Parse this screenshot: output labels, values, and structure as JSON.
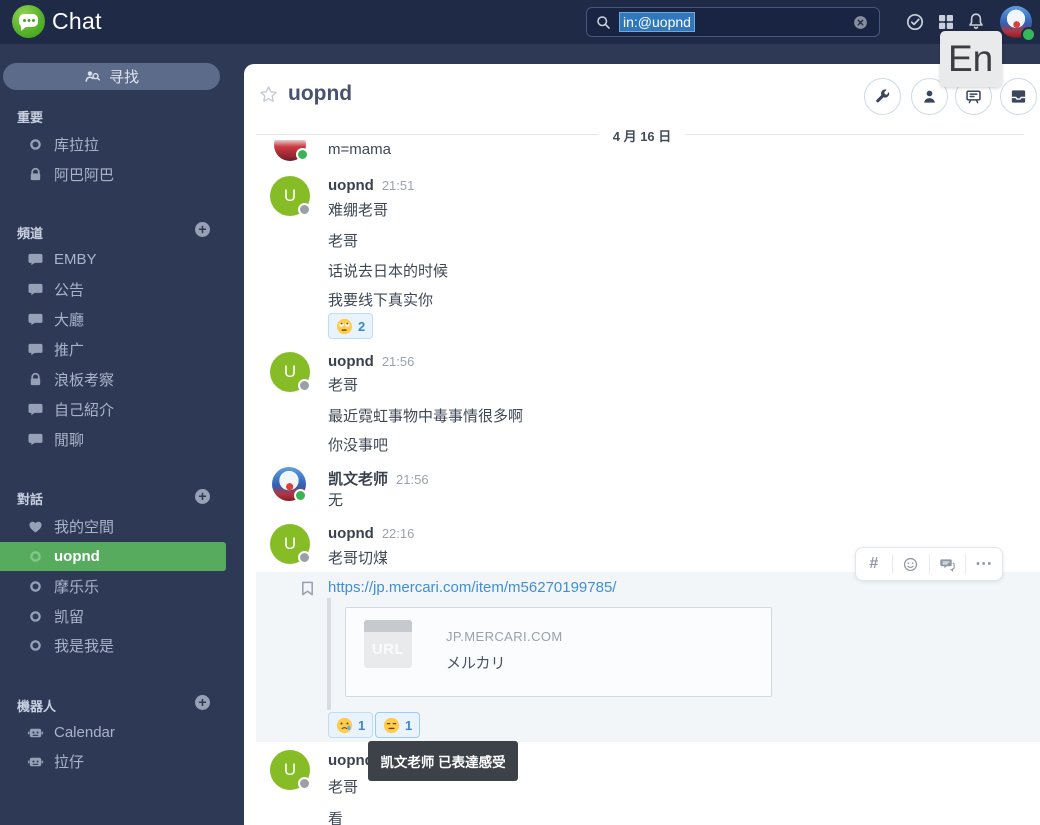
{
  "topbar": {
    "app_name": "Chat",
    "search_value": "in:@uopnd"
  },
  "ime_overlay": {
    "label": "En"
  },
  "sidebar": {
    "find_button": "寻找",
    "sections": [
      {
        "label": "重要",
        "items": [
          {
            "label": "库拉拉",
            "icon": "ring"
          },
          {
            "label": "阿巴阿巴",
            "icon": "lock"
          }
        ]
      },
      {
        "label": "頻道",
        "items": [
          {
            "label": "EMBY",
            "icon": "speech-bubble"
          },
          {
            "label": "公告",
            "icon": "speech-bubble"
          },
          {
            "label": "大廳",
            "icon": "speech-bubble"
          },
          {
            "label": "推广",
            "icon": "speech-bubble"
          },
          {
            "label": "浪板考察",
            "icon": "lock"
          },
          {
            "label": "自己紹介",
            "icon": "speech-bubble"
          },
          {
            "label": "閒聊",
            "icon": "speech-bubble"
          }
        ]
      },
      {
        "label": "對話",
        "items": [
          {
            "label": "我的空間",
            "icon": "heart"
          },
          {
            "label": "uopnd",
            "icon": "ring",
            "active": true
          },
          {
            "label": "摩乐乐",
            "icon": "ring"
          },
          {
            "label": "凯留",
            "icon": "ring"
          },
          {
            "label": "我是我是",
            "icon": "ring"
          }
        ]
      },
      {
        "label": "機器人",
        "items": [
          {
            "label": "Calendar",
            "icon": "robot"
          },
          {
            "label": "拉仔",
            "icon": "robot"
          }
        ]
      }
    ]
  },
  "main": {
    "header": {
      "title": "uopnd"
    },
    "date_divider": "4 月 16 日",
    "toolbar": {
      "hash": "#",
      "more": "⋯"
    },
    "tooltip": "凯文老师 已表達感受",
    "messages": {
      "mama": {
        "text": "m=mama"
      },
      "m1": {
        "user": "uopnd",
        "avatar_letter": "U",
        "time": "21:51",
        "text": "难绷老哥",
        "followups": [
          "老哥",
          "话说去日本的时候",
          "我要线下真实你"
        ],
        "reaction": {
          "emoji": "face-with-rolling-eyes",
          "count": "2"
        }
      },
      "m2": {
        "user": "uopnd",
        "avatar_letter": "U",
        "time": "21:56",
        "text": "老哥",
        "followups": [
          "最近霓虹事物中毒事情很多啊",
          "你没事吧"
        ]
      },
      "m3": {
        "user": "凯文老师",
        "time": "21:56",
        "text": "无"
      },
      "m4": {
        "user": "uopnd",
        "avatar_letter": "U",
        "time": "22:16",
        "text": "老哥切煤"
      },
      "link_msg": {
        "url": "https://jp.mercari.com/item/m56270199785/",
        "preview": {
          "icon_label": "URL",
          "site": "JP.MERCARI.COM",
          "title": "メルカリ"
        },
        "reactions": [
          {
            "emoji": "crying-face",
            "count": "1"
          },
          {
            "emoji": "expressionless-face",
            "count": "1"
          }
        ]
      },
      "m5": {
        "user": "uopnd",
        "avatar_letter": "U",
        "text": "老哥",
        "followups": [
          "看"
        ]
      }
    }
  },
  "colors": {
    "topbar_bg": "#1f2a47",
    "sidebar_bg": "#2e3a55",
    "active_green": "#57ab5f",
    "avatar_green": "#86bc25",
    "link_blue": "#3f8ed6",
    "selection_blue": "#2e78bb",
    "reaction_blue": "#3d87cf",
    "tooltip_bg": "#3d4249"
  }
}
